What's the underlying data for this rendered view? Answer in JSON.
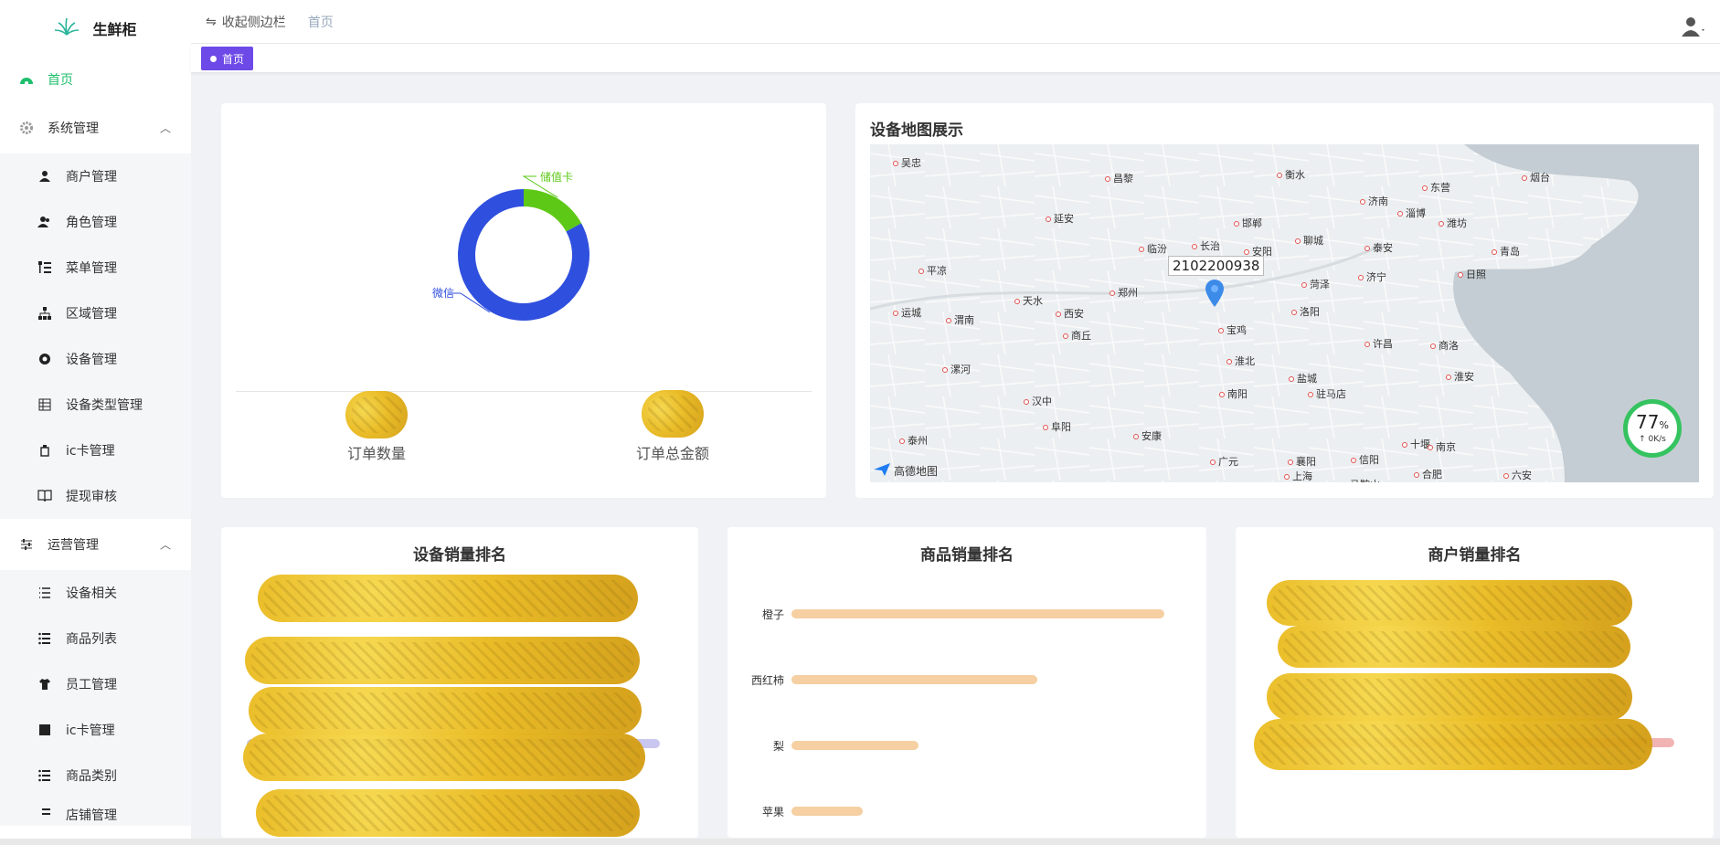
{
  "app": {
    "name": "生鲜柜"
  },
  "sidebar": {
    "home": "首页",
    "groups": [
      {
        "label": "系统管理",
        "items": [
          "商户管理",
          "角色管理",
          "菜单管理",
          "区域管理",
          "设备管理",
          "设备类型管理",
          "ic卡管理",
          "提现审核"
        ]
      },
      {
        "label": "运营管理",
        "items": [
          "设备相关",
          "商品列表",
          "员工管理",
          "ic卡管理",
          "商品类别",
          "店铺管理"
        ]
      }
    ]
  },
  "topbar": {
    "collapse_label": "收起侧边栏",
    "breadcrumb": "首页"
  },
  "tags": {
    "active": "首页"
  },
  "donut_card": {
    "chart_data": {
      "type": "pie",
      "slices": [
        {
          "name": "储值卡",
          "value": 17
        },
        {
          "name": "微信",
          "value": 83
        }
      ],
      "colors": [
        "#5ec817",
        "#2f4fde"
      ]
    },
    "stats": [
      {
        "label": "订单数量"
      },
      {
        "label": "订单总金额"
      }
    ]
  },
  "map_card": {
    "title": "设备地图展示",
    "marker_label": "2102200938",
    "attribution": "高德地图",
    "cities": [
      "吴忠",
      "昌黎",
      "衡水",
      "烟台",
      "东营",
      "济南",
      "淄博",
      "潍坊",
      "延安",
      "邯郸",
      "长治",
      "临汾",
      "聊城",
      "泰安",
      "安阳",
      "青岛",
      "平凉",
      "菏泽",
      "济宁",
      "日照",
      "郑州",
      "运城",
      "天水",
      "西安",
      "渭南",
      "洛阳",
      "宝鸡",
      "商丘",
      "许昌",
      "商洛",
      "淮北",
      "淮安",
      "漯河",
      "盐城",
      "汉中",
      "南阳",
      "驻马店",
      "阜阳",
      "安康",
      "十堰",
      "南京",
      "泰州",
      "广元",
      "襄阳",
      "信阳",
      "合肥",
      "马鞍山",
      "六安",
      "上海"
    ],
    "net_badge": {
      "percent": "77",
      "unit": "%",
      "speed": "0K/s"
    }
  },
  "device_rank": {
    "title": "设备销量排名"
  },
  "product_rank": {
    "title": "商品销量排名",
    "chart_data": {
      "type": "bar",
      "categories": [
        "橙子",
        "西红柿",
        "梨",
        "苹果"
      ],
      "values": [
        100,
        66,
        34,
        19
      ]
    }
  },
  "merchant_rank": {
    "title": "商户销量排名"
  },
  "colors": {
    "accent": "#1fbf6c",
    "tag": "#6d4ae8",
    "bar": "#f6cfa2"
  }
}
